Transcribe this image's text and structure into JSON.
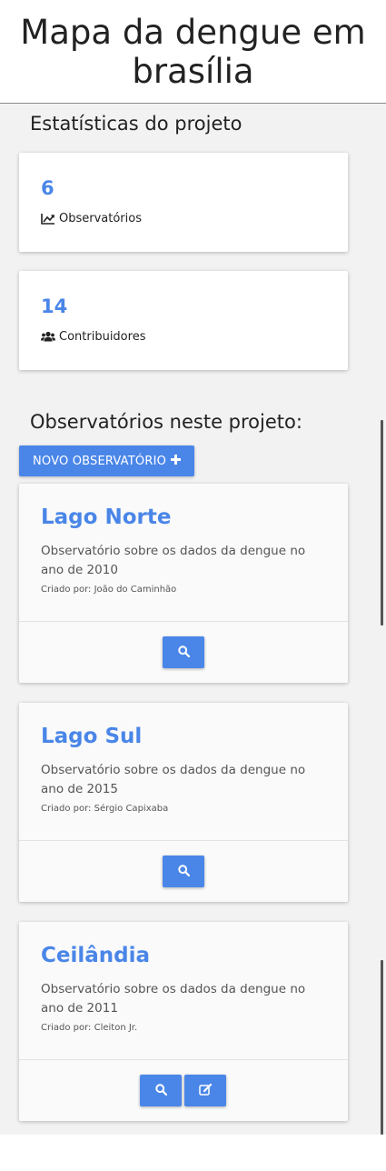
{
  "header": {
    "title": "Mapa da dengue em brasília"
  },
  "stats": {
    "section_title": "Estatísticas do projeto",
    "items": [
      {
        "value": "6",
        "label": "Observatórios",
        "icon": "chart-line-icon"
      },
      {
        "value": "14",
        "label": "Contribuidores",
        "icon": "users-icon"
      }
    ]
  },
  "observatories": {
    "section_title": "Observatórios neste projeto:",
    "new_button_label": "NOVO OBSERVATÓRIO",
    "items": [
      {
        "title": "Lago Norte",
        "description": "Observatório sobre os dados da dengue no ano de 2010",
        "author": "Criado por: João do Caminhão",
        "actions": [
          "search-icon"
        ]
      },
      {
        "title": "Lago Sul",
        "description": "Observatório sobre os dados da dengue no ano de 2015",
        "author": "Criado por: Sérgio Capixaba",
        "actions": [
          "search-icon"
        ]
      },
      {
        "title": "Ceilândia",
        "description": "Observatório sobre os dados da dengue no ano de 2011",
        "author": "Criado por: Cleiton Jr.",
        "actions": [
          "search-icon",
          "edit-icon"
        ]
      }
    ]
  },
  "colors": {
    "accent": "#4a86e8",
    "background": "#f2f2f2",
    "card": "#ffffff"
  }
}
